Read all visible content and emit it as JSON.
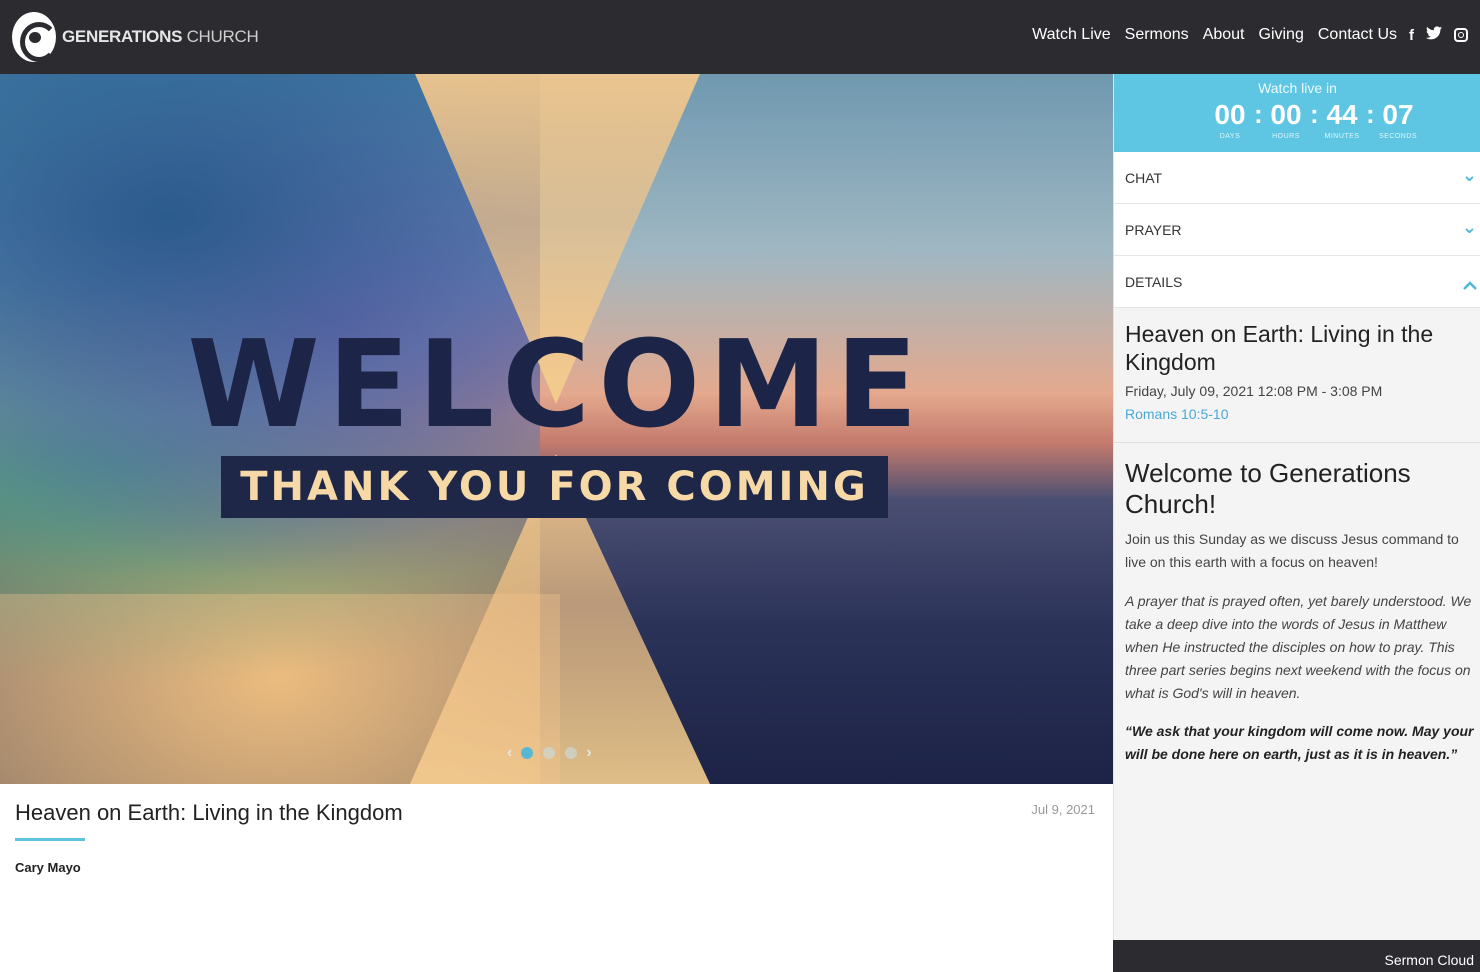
{
  "header": {
    "logo_bold": "GENERATIONS",
    "logo_light": "CHURCH",
    "nav": [
      "Watch Live",
      "Sermons",
      "About",
      "Giving",
      "Contact Us"
    ],
    "social": [
      "facebook-icon",
      "twitter-icon",
      "instagram-icon"
    ]
  },
  "hero": {
    "headline": "WELCOME",
    "subline": "THANK YOU FOR COMING",
    "slides_count": 3,
    "active_slide": 1
  },
  "sermon": {
    "title": "Heaven on Earth: Living in the Kingdom",
    "date": "Jul 9, 2021",
    "speaker": "Cary Mayo"
  },
  "countdown": {
    "label": "Watch live in",
    "days": "00",
    "hours": "00",
    "minutes": "44",
    "seconds": "07",
    "days_cap": "DAYS",
    "hours_cap": "HOURS",
    "minutes_cap": "MINUTES",
    "seconds_cap": "SECONDS"
  },
  "accordion": {
    "chat": "CHAT",
    "prayer": "PRAYER",
    "details": "DETAILS"
  },
  "details": {
    "title": "Heaven on Earth: Living in the Kingdom",
    "when": "Friday, July 09, 2021 12:08 PM - 3:08 PM",
    "scripture": "Romans 10:5-10",
    "heading": "Welcome to Generations Church!",
    "para1": "Join us this Sunday as we discuss Jesus command to live on this earth with a focus on heaven!",
    "para2": "A prayer that is prayed often, yet barely understood. We take a deep dive into the words of Jesus in Matthew when He instructed the disciples on how to pray. This three part series begins next weekend with the focus on what is God's will in heaven.",
    "para3": "“We ask that your kingdom will come now. May your will be done here on earth, just as it is in heaven.”"
  },
  "footer": {
    "sermon_cloud": "Sermon Cloud"
  },
  "colors": {
    "header_bg": "#2b2b30",
    "accent": "#5ec6e2",
    "hero_navy": "#1c2547",
    "hero_cream": "#f6d9a6"
  }
}
